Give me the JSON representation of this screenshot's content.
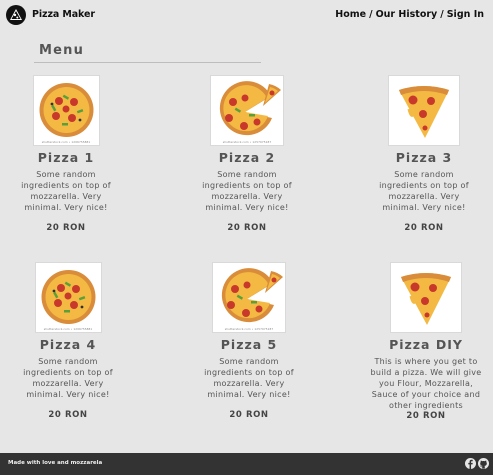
{
  "app": {
    "brand": "Pizza Maker"
  },
  "nav": {
    "items": [
      {
        "label": "Home"
      },
      {
        "label": "Our History"
      },
      {
        "label": "Sign In"
      }
    ],
    "separator": "/"
  },
  "menu": {
    "title": "Menu"
  },
  "pizzas": [
    {
      "name": "Pizza 1",
      "description": "Some random ingredients on top of mozzarella. Very minimal. Very nice!",
      "price": "20 RON",
      "image_caption": "shutterstock.com • 1206755881",
      "icon": "whole-pizza-icon"
    },
    {
      "name": "Pizza 2",
      "description": "Some random ingredients on top of mozzarella. Very minimal. Very nice!",
      "price": "20 RON",
      "image_caption": "shutterstock.com • 1257075187",
      "icon": "pizza-missing-slice-icon"
    },
    {
      "name": "Pizza 3",
      "description": "Some random ingredients on top of mozzarella. Very minimal. Very nice!",
      "price": "20 RON",
      "image_caption": "",
      "icon": "pizza-slice-icon"
    },
    {
      "name": "Pizza 4",
      "description": "Some random ingredients on top of mozzarella. Very minimal. Very nice!",
      "price": "20 RON",
      "image_caption": "shutterstock.com • 1206755881",
      "icon": "whole-pizza-icon"
    },
    {
      "name": "Pizza 5",
      "description": "Some random ingredients on top of mozzarella. Very minimal. Very nice!",
      "price": "20 RON",
      "image_caption": "shutterstock.com • 1257075187",
      "icon": "pizza-missing-slice-icon"
    },
    {
      "name": "Pizza DIY",
      "description": "This is where you get to build a pizza. We will give you Flour, Mozzarella, Sauce of your choice and other ingredients",
      "price": "20 RON",
      "image_caption": "",
      "icon": "pizza-slice-icon"
    }
  ],
  "footer": {
    "note": "Made with love and mozzarela",
    "icons": [
      "facebook-icon",
      "github-icon"
    ]
  },
  "colors": {
    "background": "#e6e6e6",
    "footer": "#333333",
    "text": "#555555",
    "crust": "#d98c3a",
    "cheese": "#f4b942",
    "pepperoni": "#c8392b",
    "pepper": "#5aa03a"
  }
}
